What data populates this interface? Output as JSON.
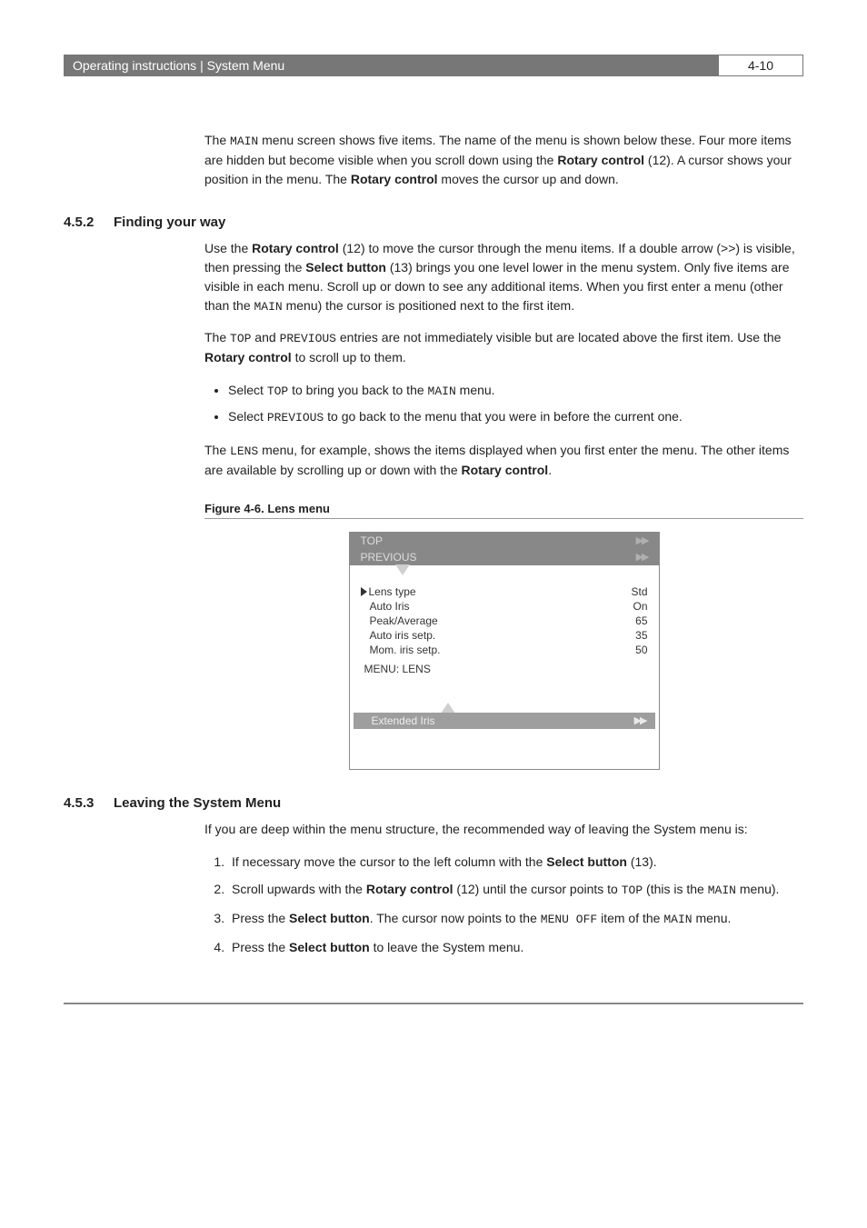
{
  "header": {
    "title": "Operating instructions | System Menu",
    "page": "4-10"
  },
  "intro": {
    "p1a": "The ",
    "p1b": "MAIN",
    "p1c": " menu screen shows five items. The name of the menu is shown below these. Four more items are hidden but become visible when you scroll down using the ",
    "p1d": "Rotary control",
    "p1e": " (12). A cursor shows your position in the menu. The ",
    "p1f": "Rotary control",
    "p1g": " moves the cursor up and down."
  },
  "s452": {
    "num": "4.5.2",
    "title": "Finding your way",
    "p1a": "Use the ",
    "p1b": "Rotary control",
    "p1c": " (12) to move the cursor through the menu items. If a double arrow (>>) is visible, then pressing the ",
    "p1d": "Select button",
    "p1e": " (13) brings you one level lower in the menu system. Only five items are visible in each menu. Scroll up or down to see any additional items. When you first enter a menu (other than the ",
    "p1f": "MAIN",
    "p1g": " menu) the cursor is positioned next to the first item.",
    "p2a": "The ",
    "p2b": "TOP",
    "p2c": " and ",
    "p2d": "PREVIOUS",
    "p2e": " entries are not immediately visible but are located above the first item. Use the ",
    "p2f": "Rotary control",
    "p2g": " to scroll up to them.",
    "b1a": "Select ",
    "b1b": "TOP",
    "b1c": " to bring you back to the ",
    "b1d": "MAIN",
    "b1e": " menu.",
    "b2a": "Select ",
    "b2b": "PREVIOUS",
    "b2c": " to go back to the menu that you were in before the current one.",
    "p3a": "The ",
    "p3b": "LENS",
    "p3c": " menu, for example, shows the items displayed when you first enter the menu. The other items are available by scrolling up or down with the ",
    "p3d": "Rotary control",
    "p3e": "."
  },
  "figure": {
    "label": "Figure 4-6.  Lens menu",
    "top": "TOP",
    "previous": "PREVIOUS",
    "items": [
      {
        "name": "Lens type",
        "val": "Std"
      },
      {
        "name": "Auto Iris",
        "val": "On"
      },
      {
        "name": "Peak/Average",
        "val": "65"
      },
      {
        "name": "Auto iris setp.",
        "val": "35"
      },
      {
        "name": "Mom. iris setp.",
        "val": "50"
      }
    ],
    "menu_name": "MENU:  LENS",
    "extended": "Extended Iris"
  },
  "s453": {
    "num": "4.5.3",
    "title": "Leaving the System Menu",
    "p1": "If you are deep within the menu structure, the recommended way of leaving the System menu is:",
    "step1a": "If necessary move the cursor to the left column with the ",
    "step1b": "Select button",
    "step1c": " (13).",
    "step2a": "Scroll upwards with the ",
    "step2b": "Rotary control",
    "step2c": " (12) until the cursor points to ",
    "step2d": "TOP",
    "step2e": " (this is the ",
    "step2f": "MAIN",
    "step2g": " menu).",
    "step3a": "Press the ",
    "step3b": "Select button",
    "step3c": ". The cursor now points to the ",
    "step3d": "MENU OFF",
    "step3e": " item of the ",
    "step3f": "MAIN",
    "step3g": " menu.",
    "step4a": "Press the ",
    "step4b": "Select button",
    "step4c": " to leave the System menu."
  }
}
